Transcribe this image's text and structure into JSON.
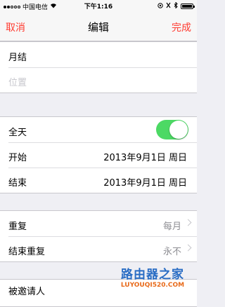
{
  "status_bar": {
    "carrier": "中国电信",
    "time": "下午1:16",
    "battery_level": 0.85
  },
  "nav": {
    "cancel": "取消",
    "title": "编辑",
    "done": "完成"
  },
  "event": {
    "title": "月结",
    "location_placeholder": "位置"
  },
  "schedule": {
    "all_day_label": "全天",
    "all_day_on": true,
    "start_label": "开始",
    "start_value": "2013年9月1日 周日",
    "end_label": "结束",
    "end_value": "2013年9月1日 周日"
  },
  "repeat": {
    "repeat_label": "重复",
    "repeat_value": "每月",
    "end_repeat_label": "结束重复",
    "end_repeat_value": "永不"
  },
  "invitees": {
    "label": "被邀请人"
  },
  "watermark": {
    "cn": "路由器之家",
    "en": "LUYOUQI520.COM"
  },
  "colors": {
    "accent": "#ff3b30",
    "toggle_on": "#4cd964",
    "background": "#efeff4"
  },
  "icons": [
    "signal-icon",
    "wifi-icon",
    "location-icon",
    "alarm-icon",
    "bluetooth-icon",
    "battery-icon",
    "chevron-right-icon"
  ]
}
